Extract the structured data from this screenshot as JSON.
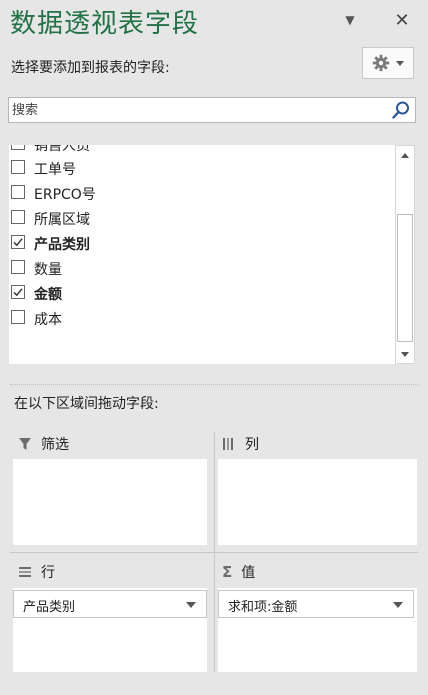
{
  "panel": {
    "title": "数据透视表字段",
    "subtitle": "选择要添加到报表的字段:",
    "search_placeholder": "搜索"
  },
  "fields": [
    {
      "label": "销售人员",
      "checked": false,
      "bold": false
    },
    {
      "label": "工单号",
      "checked": false,
      "bold": false
    },
    {
      "label": "ERPCO号",
      "checked": false,
      "bold": false
    },
    {
      "label": "所属区域",
      "checked": false,
      "bold": false
    },
    {
      "label": "产品类别",
      "checked": true,
      "bold": true
    },
    {
      "label": "数量",
      "checked": false,
      "bold": false
    },
    {
      "label": "金额",
      "checked": true,
      "bold": true
    },
    {
      "label": "成本",
      "checked": false,
      "bold": false
    }
  ],
  "areas": {
    "drag_instruction": "在以下区域间拖动字段:",
    "filters": {
      "label": "筛选",
      "icon": "filter-icon"
    },
    "columns": {
      "label": "列",
      "icon": "columns-icon"
    },
    "rows": {
      "label": "行",
      "icon": "rows-icon",
      "item": "产品类别"
    },
    "values": {
      "label": "值",
      "icon": "sigma-icon",
      "item": "求和项:金额"
    }
  },
  "colors": {
    "title": "#217346",
    "accent_search": "#2b579a"
  }
}
